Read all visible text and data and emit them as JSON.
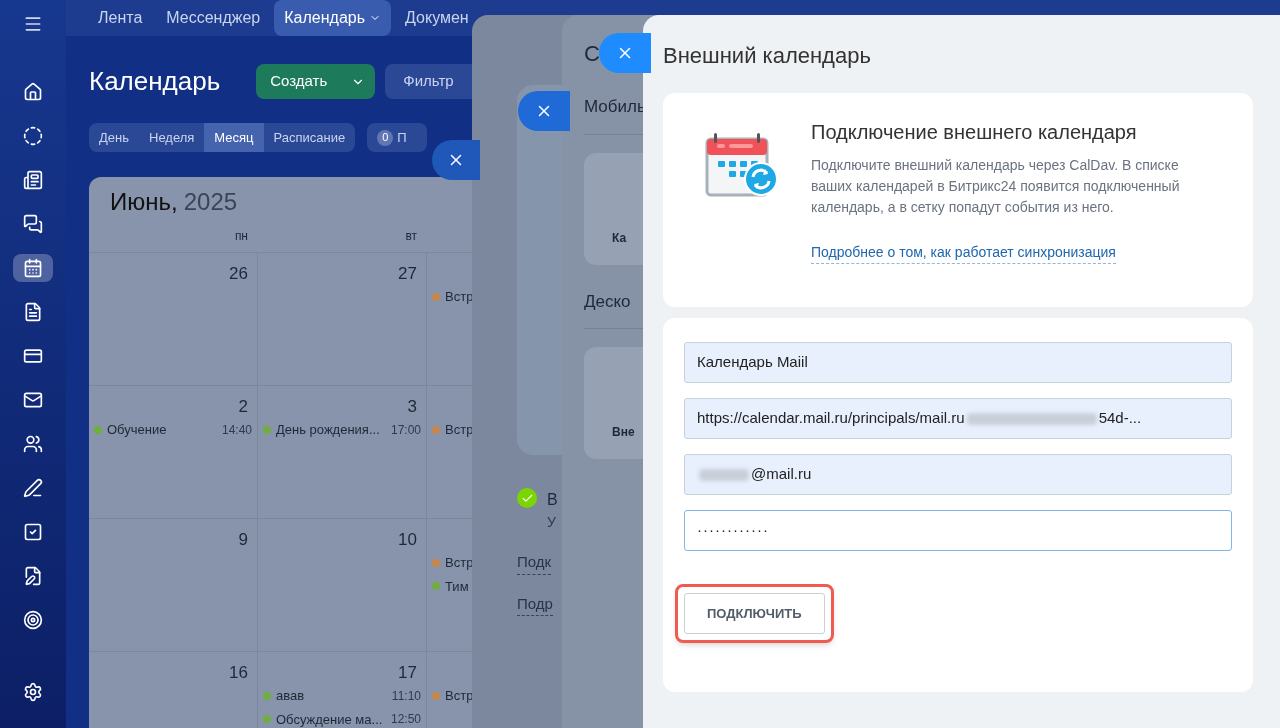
{
  "top_nav": [
    {
      "label": "Лента",
      "selected": false,
      "dropdown": false
    },
    {
      "label": "Мессенджер",
      "selected": false,
      "dropdown": false
    },
    {
      "label": "Календарь",
      "selected": true,
      "dropdown": true
    },
    {
      "label": "Докумен",
      "selected": false,
      "dropdown": false
    }
  ],
  "sidebar": {
    "items": [
      {
        "selected": false
      },
      {
        "selected": false
      },
      {
        "selected": false
      },
      {
        "selected": false
      },
      {
        "selected": true
      },
      {
        "selected": false
      },
      {
        "selected": false
      },
      {
        "selected": false
      },
      {
        "selected": false
      },
      {
        "selected": false
      },
      {
        "selected": false
      },
      {
        "selected": false
      },
      {
        "selected": false
      }
    ]
  },
  "calendar": {
    "title": "Календарь",
    "create_button": "Создать",
    "filter": "Фильтр",
    "views": [
      {
        "label": "День",
        "selected": false
      },
      {
        "label": "Неделя",
        "selected": false
      },
      {
        "label": "Месяц",
        "selected": true
      },
      {
        "label": "Расписание",
        "selected": false
      }
    ],
    "counter": {
      "count": "0",
      "label": "П"
    },
    "month": "Июнь,",
    "year": "2025",
    "weekdays": [
      "пн",
      "вт"
    ],
    "weeks": [
      {
        "days": [
          {
            "day": "26"
          },
          {
            "day": "27"
          },
          {
            "events": [
              {
                "title": "Встр",
                "color": "#c8874a"
              }
            ]
          }
        ]
      },
      {
        "days": [
          {
            "day": "2",
            "events": [
              {
                "title": "Обучение",
                "time": "14:40",
                "color": "#6fae3f"
              }
            ]
          },
          {
            "day": "3",
            "events": [
              {
                "title": "День рождения...",
                "time": "17:00",
                "color": "#6fae3f"
              }
            ]
          },
          {
            "events": [
              {
                "title": "Встр",
                "color": "#c8874a"
              }
            ]
          }
        ]
      },
      {
        "days": [
          {
            "day": "9"
          },
          {
            "day": "10"
          },
          {
            "events": [
              {
                "title": "Встр",
                "color": "#c8874a"
              },
              {
                "title": "Тим",
                "color": "#6fae3f"
              }
            ]
          }
        ]
      },
      {
        "days": [
          {
            "day": "16"
          },
          {
            "day": "17",
            "events": [
              {
                "title": "авав",
                "time": "11:10",
                "color": "#6fae3f"
              },
              {
                "title": "Обсуждение ма...",
                "time": "12:50",
                "color": "#6fae3f"
              }
            ]
          },
          {
            "events": [
              {
                "title": "Встр",
                "color": "#c8874a"
              }
            ]
          }
        ]
      }
    ]
  },
  "back_panel": {
    "status": "В",
    "status_sub": "У",
    "links": [
      "Подк",
      "Подр"
    ]
  },
  "middle_panel": {
    "title": "С",
    "sections": [
      {
        "heading": "Мобиль",
        "card": "Ка"
      },
      {
        "heading": "Деско",
        "card": "Вне"
      }
    ]
  },
  "front_panel": {
    "title": "Внешний календарь",
    "intro": {
      "heading": "Подключение внешнего календаря",
      "text": "Подключите внешний календарь через CalDav. В списке ваших календарей в Битрикс24 появится подключенный календарь, а в сетку попадут события из него.",
      "link": "Подробнее о том, как работает синхронизация"
    },
    "fields": [
      {
        "kind": "text",
        "value": "Календарь Maiil",
        "focused": false
      },
      {
        "kind": "masked",
        "value_start": "https://calendar.mail.ru/principals/mail.ru",
        "value_end": "54d-...",
        "focused": false
      },
      {
        "kind": "masked",
        "value_end": "@mail.ru",
        "focused": false
      },
      {
        "kind": "password",
        "value": "············",
        "focused": true
      }
    ],
    "connect_button": "ПОДКЛЮЧИТЬ",
    "button_highlighted": true
  }
}
